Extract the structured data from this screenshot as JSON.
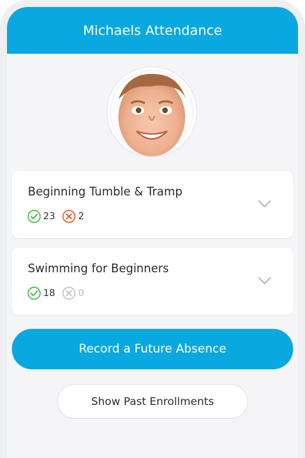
{
  "header": {
    "title": "Michaels Attendance"
  },
  "avatar": {
    "alt": "child profile photo"
  },
  "enrollments": [
    {
      "name": "Beginning Tumble & Tramp",
      "present_count": "23",
      "absent_count": "2"
    },
    {
      "name": "Swimming for Beginners",
      "present_count": "18",
      "absent_count": "0"
    }
  ],
  "actions": {
    "record_absence_label": "Record a Future Absence",
    "show_past_label": "Show Past Enrollments"
  },
  "colors": {
    "brand_blue": "#0aa8e0",
    "present_green": "#4cb848",
    "absent_red": "#e8572e",
    "muted_gray": "#c4c4c4"
  }
}
